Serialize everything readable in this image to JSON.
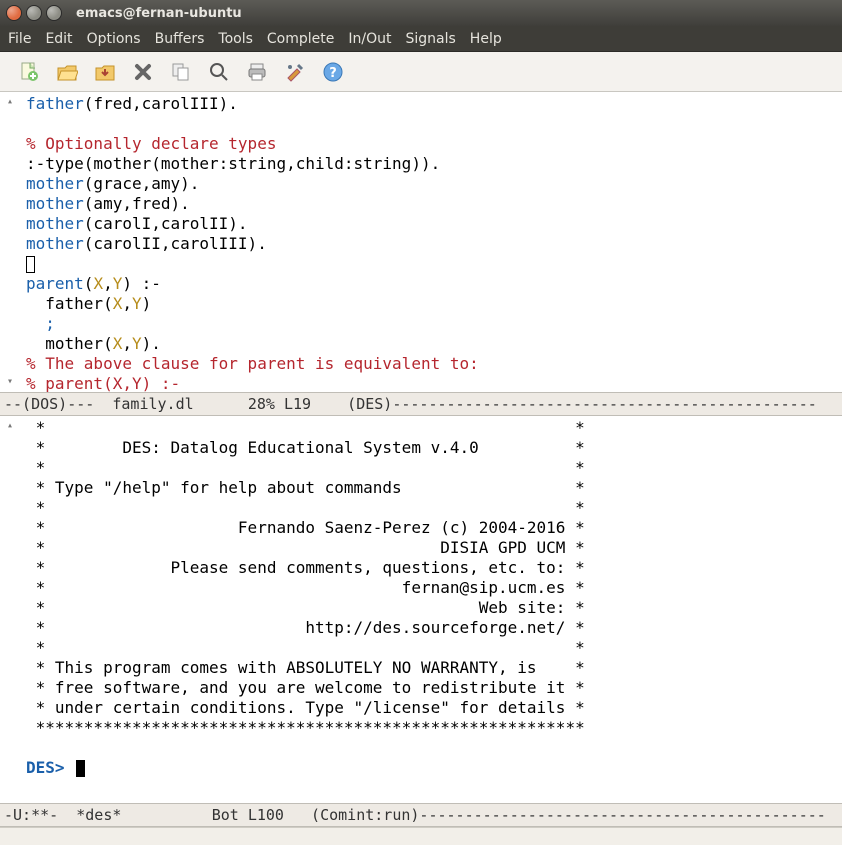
{
  "window": {
    "title": "emacs@fernan-ubuntu"
  },
  "menubar": [
    "File",
    "Edit",
    "Options",
    "Buffers",
    "Tools",
    "Complete",
    "In/Out",
    "Signals",
    "Help"
  ],
  "toolbar": [
    {
      "name": "new-file-icon"
    },
    {
      "name": "open-file-icon"
    },
    {
      "name": "save-icon"
    },
    {
      "name": "close-icon"
    },
    {
      "name": "copy-icon"
    },
    {
      "name": "search-icon"
    },
    {
      "name": "print-icon"
    },
    {
      "name": "preferences-icon"
    },
    {
      "name": "help-icon"
    }
  ],
  "buffer1": {
    "lines": [
      {
        "segs": [
          {
            "t": "father",
            "c": "kw"
          },
          {
            "t": "(fred,carolIII).",
            "c": "punc"
          }
        ]
      },
      {
        "segs": []
      },
      {
        "segs": [
          {
            "t": "% Optionally declare types",
            "c": "com"
          }
        ]
      },
      {
        "segs": [
          {
            "t": ":-type(mother(mother:string,child:string)).",
            "c": "punc"
          }
        ]
      },
      {
        "segs": [
          {
            "t": "mother",
            "c": "kw"
          },
          {
            "t": "(grace,amy).",
            "c": "punc"
          }
        ]
      },
      {
        "segs": [
          {
            "t": "mother",
            "c": "kw"
          },
          {
            "t": "(amy,fred).",
            "c": "punc"
          }
        ]
      },
      {
        "segs": [
          {
            "t": "mother",
            "c": "kw"
          },
          {
            "t": "(carolI,carolII).",
            "c": "punc"
          }
        ]
      },
      {
        "segs": [
          {
            "t": "mother",
            "c": "kw"
          },
          {
            "t": "(carolII,carolIII).",
            "c": "punc"
          }
        ]
      },
      {
        "segs": [
          {
            "t": "",
            "c": "punc",
            "box": true
          }
        ]
      },
      {
        "segs": [
          {
            "t": "parent",
            "c": "kw"
          },
          {
            "t": "(",
            "c": "punc"
          },
          {
            "t": "X",
            "c": "var"
          },
          {
            "t": ",",
            "c": "punc"
          },
          {
            "t": "Y",
            "c": "var"
          },
          {
            "t": ") :-",
            "c": "punc"
          }
        ]
      },
      {
        "segs": [
          {
            "t": "  father(",
            "c": "punc"
          },
          {
            "t": "X",
            "c": "var"
          },
          {
            "t": ",",
            "c": "punc"
          },
          {
            "t": "Y",
            "c": "var"
          },
          {
            "t": ")",
            "c": "punc"
          }
        ]
      },
      {
        "segs": [
          {
            "t": "  ;",
            "c": "kw"
          }
        ]
      },
      {
        "segs": [
          {
            "t": "  mother(",
            "c": "punc"
          },
          {
            "t": "X",
            "c": "var"
          },
          {
            "t": ",",
            "c": "punc"
          },
          {
            "t": "Y",
            "c": "var"
          },
          {
            "t": ").",
            "c": "punc"
          }
        ]
      },
      {
        "segs": [
          {
            "t": "% The above clause for parent is equivalent to:",
            "c": "com"
          }
        ]
      },
      {
        "segs": [
          {
            "t": "% parent(X,Y) :-",
            "c": "com"
          }
        ]
      }
    ]
  },
  "modeline1": "--(DOS)---  family.dl      28% L19    (DES)-----------------------------------------------",
  "buffer2": {
    "lines": [
      " *                                                       *",
      " *        DES: Datalog Educational System v.4.0          *",
      " *                                                       *",
      " * Type \"/help\" for help about commands                  *",
      " *                                                       *",
      " *                    Fernando Saenz-Perez (c) 2004-2016 *",
      " *                                         DISIA GPD UCM *",
      " *             Please send comments, questions, etc. to: *",
      " *                                     fernan@sip.ucm.es *",
      " *                                             Web site: *",
      " *                           http://des.sourceforge.net/ *",
      " *                                                       *",
      " * This program comes with ABSOLUTELY NO WARRANTY, is    *",
      " * free software, and you are welcome to redistribute it *",
      " * under certain conditions. Type \"/license\" for details *",
      " *********************************************************",
      ""
    ],
    "prompt": "DES> "
  },
  "modeline2": "-U:**-  *des*          Bot L100   (Comint:run)---------------------------------------------"
}
